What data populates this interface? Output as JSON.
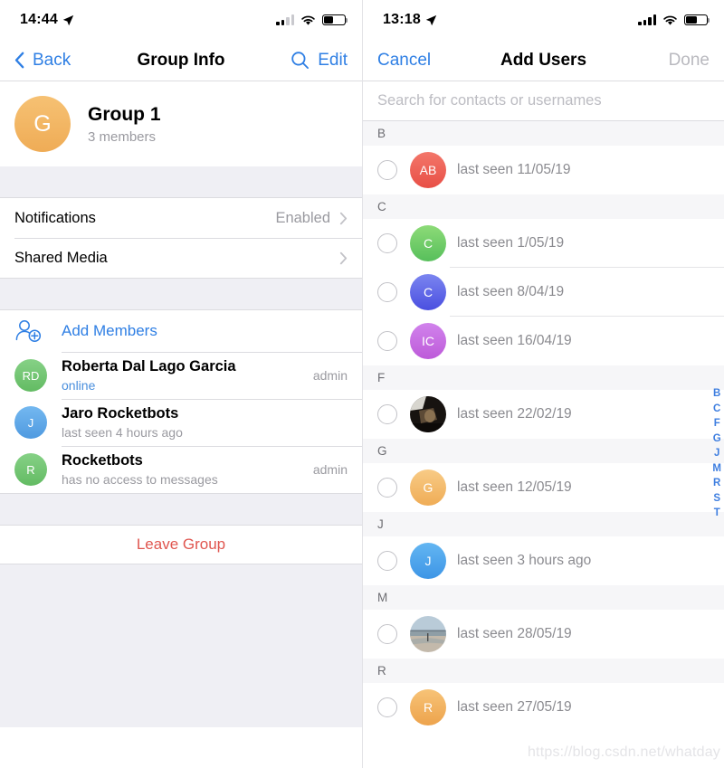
{
  "left": {
    "statusbar": {
      "time": "14:44",
      "location_icon": "location-arrow-icon",
      "signal_bars_filled": 2,
      "signal_bars_total": 4,
      "wifi_icon": "wifi-icon",
      "battery_percent": 45
    },
    "navbar": {
      "back_label": "Back",
      "back_icon": "chevron-left-icon",
      "title": "Group Info",
      "search_icon": "search-icon",
      "edit_label": "Edit"
    },
    "group": {
      "avatar_initial": "G",
      "avatar_color": "#efac56",
      "name": "Group 1",
      "members_count_label": "3 members"
    },
    "settings_rows": [
      {
        "label": "Notifications",
        "value": "Enabled",
        "chevron": "chevron-right-icon"
      },
      {
        "label": "Shared Media",
        "value": "",
        "chevron": "chevron-right-icon"
      }
    ],
    "add_members": {
      "icon": "add-person-icon",
      "label": "Add Members"
    },
    "members": [
      {
        "initials": "RD",
        "color": "#72c472",
        "name": "Roberta Dal Lago Garcia",
        "status": "online",
        "status_online": true,
        "tag": "admin"
      },
      {
        "initials": "J",
        "color": "#5fa8e8",
        "name": "Jaro Rocketbots",
        "status": "last seen 4 hours ago",
        "status_online": false,
        "tag": ""
      },
      {
        "initials": "R",
        "color": "#72c472",
        "name": "Rocketbots",
        "status": "has no access to messages",
        "status_online": false,
        "tag": "admin"
      }
    ],
    "leave_label": "Leave Group",
    "leave_color": "#e0564f"
  },
  "right": {
    "statusbar": {
      "time": "13:18",
      "location_icon": "location-arrow-icon",
      "signal_bars_filled": 4,
      "signal_bars_total": 4,
      "wifi_icon": "wifi-icon",
      "battery_percent": 55
    },
    "navbar": {
      "cancel_label": "Cancel",
      "title": "Add Users",
      "done_label": "Done",
      "done_enabled": false
    },
    "search": {
      "value": "",
      "placeholder": "Search for contacts or usernames"
    },
    "sections": [
      {
        "letter": "B",
        "contacts": [
          {
            "initials": "AB",
            "color": "#ef6356",
            "photo": false,
            "status": "last seen 11/05/19",
            "checked": false
          }
        ]
      },
      {
        "letter": "C",
        "contacts": [
          {
            "initials": "C",
            "color": "#73c96a",
            "photo": false,
            "status": "last seen 1/05/19",
            "checked": false
          },
          {
            "initials": "C",
            "color": "#5c63e8",
            "photo": false,
            "status": "last seen 8/04/19",
            "checked": false
          },
          {
            "initials": "IC",
            "color": "#c462e0",
            "photo": false,
            "status": "last seen 16/04/19",
            "checked": false
          }
        ]
      },
      {
        "letter": "F",
        "contacts": [
          {
            "initials": "",
            "color": "",
            "photo": true,
            "photo_kind": "dark-indoor",
            "status": "last seen 22/02/19",
            "checked": false
          }
        ]
      },
      {
        "letter": "G",
        "contacts": [
          {
            "initials": "G",
            "color": "#f4b860",
            "photo": false,
            "status": "last seen 12/05/19",
            "checked": false
          }
        ]
      },
      {
        "letter": "J",
        "contacts": [
          {
            "initials": "J",
            "color": "#4ea3ec",
            "photo": false,
            "status": "last seen 3 hours ago",
            "checked": false
          }
        ]
      },
      {
        "letter": "M",
        "contacts": [
          {
            "initials": "",
            "color": "",
            "photo": true,
            "photo_kind": "beach",
            "status": "last seen 28/05/19",
            "checked": false
          }
        ]
      },
      {
        "letter": "R",
        "contacts": [
          {
            "initials": "R",
            "color": "#f0ad5a",
            "photo": false,
            "status": "last seen 27/05/19",
            "checked": false
          }
        ]
      }
    ],
    "alpha_index": [
      "B",
      "C",
      "F",
      "G",
      "J",
      "M",
      "R",
      "S",
      "T"
    ],
    "watermark": "https://blog.csdn.net/whatday"
  }
}
